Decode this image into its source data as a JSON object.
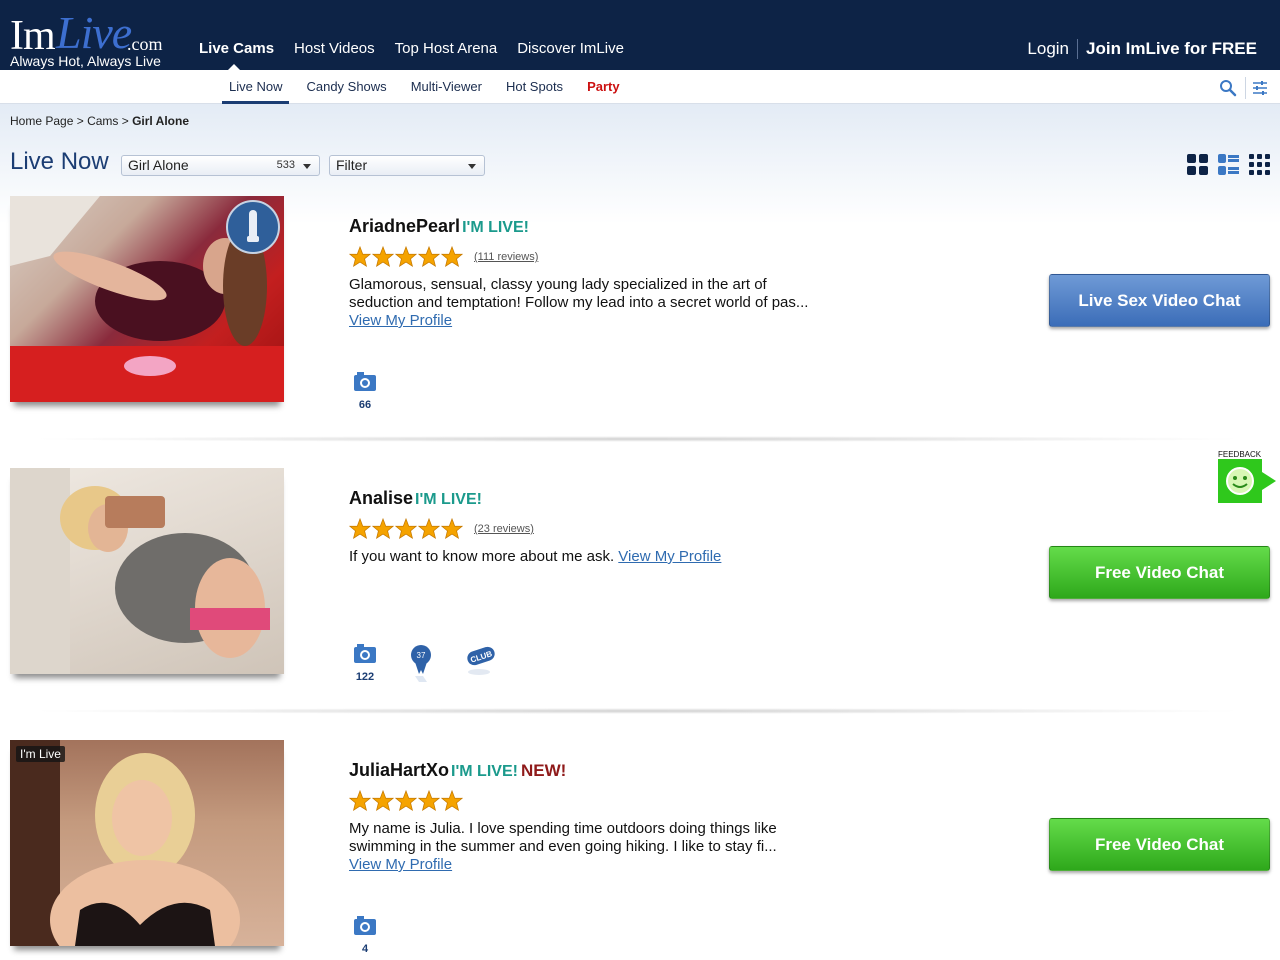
{
  "brand": {
    "logo_im": "Im",
    "logo_live": "Live",
    "logo_com": ".com",
    "tagline": "Always Hot, Always Live"
  },
  "main_nav": [
    {
      "label": "Live Cams",
      "active": true
    },
    {
      "label": "Host Videos"
    },
    {
      "label": "Top Host Arena"
    },
    {
      "label": "Discover ImLive"
    }
  ],
  "account": {
    "login_label": "Login",
    "join_label": "Join ImLive for FREE"
  },
  "sub_nav": [
    {
      "label": "Live Now",
      "active": true
    },
    {
      "label": "Candy Shows"
    },
    {
      "label": "Multi-Viewer"
    },
    {
      "label": "Hot Spots"
    },
    {
      "label": "Party"
    }
  ],
  "icons": {
    "search": "search-icon",
    "filters": "sliders-icon",
    "view_large": "grid-2x2-icon",
    "view_list": "list-view-icon",
    "view_small": "grid-3x3-icon",
    "photos": "camera-icon",
    "award": "ribbon-award-icon",
    "club": "club-badge-icon",
    "toy": "interactive-toy-icon",
    "feedback": "smiley-icon"
  },
  "breadcrumb": {
    "home": "Home Page",
    "sep1": " > ",
    "cams": "Cams",
    "sep2": " > ",
    "current": "Girl Alone"
  },
  "page_title": "Live Now",
  "category_select": {
    "value": "Girl Alone",
    "count": "533"
  },
  "filter_select": {
    "value": "Filter"
  },
  "colors": {
    "header_bg": "#0d2346",
    "accent_blue": "#1b3d73",
    "live_status": "#1b9a8c",
    "new_badge": "#8f1a1a",
    "party": "#cc1111",
    "cta_blue": "#4a7cc4",
    "cta_green": "#36b321",
    "star": "#f5a300"
  },
  "listings": [
    {
      "name": "AriadnePearl",
      "status": "I'M LIVE!",
      "new": "",
      "rating": 5,
      "reviews": "(111 reviews)",
      "description": "Glamorous, sensual, classy young lady specialized in the art of seduction and temptation! Follow my lead into a secret world of pas... ",
      "profile_link": "View My Profile",
      "photo_count": "66",
      "cta": "Live Sex Video Chat",
      "cta_style": "blue",
      "live_tag": ""
    },
    {
      "name": "Analise",
      "status": "I'M LIVE!",
      "new": "",
      "rating": 5,
      "reviews": "(23 reviews)",
      "description": "If you want to know more about me ask. ",
      "profile_link": "View My Profile",
      "photo_count": "122",
      "award_number": "37",
      "club_label": "CLUB",
      "cta": "Free Video Chat",
      "cta_style": "green",
      "live_tag": ""
    },
    {
      "name": "JuliaHartXo",
      "status": "I'M LIVE!",
      "new": "NEW!",
      "rating": 5,
      "reviews": "",
      "description": "My name is Julia. I love spending time outdoors doing things like swimming in the summer and even going hiking. I like to stay fi... ",
      "profile_link": "View My Profile",
      "photo_count": "4",
      "cta": "Free Video Chat",
      "cta_style": "green",
      "live_tag": "I'm Live"
    }
  ],
  "feedback": {
    "label": "FEEDBACK"
  }
}
